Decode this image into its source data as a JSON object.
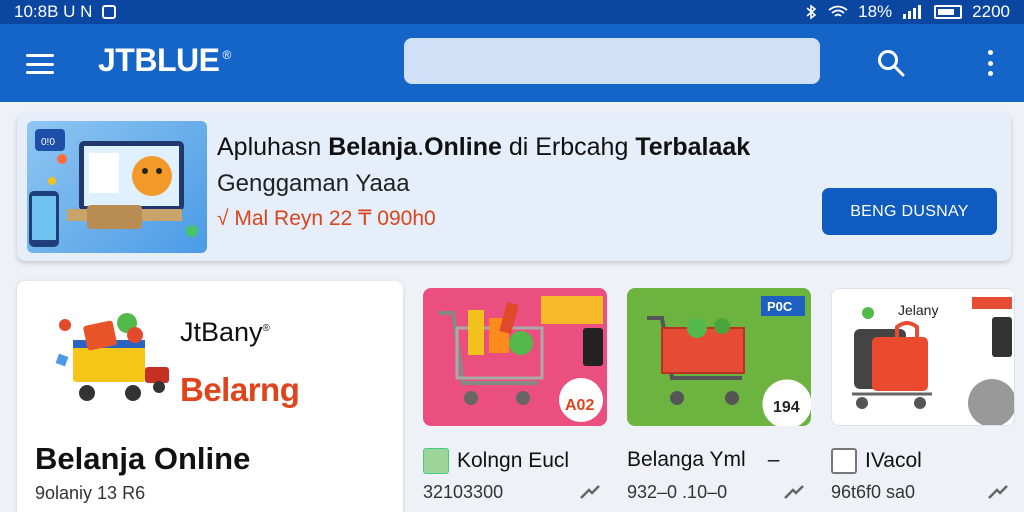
{
  "status_bar": {
    "time": "10:8B U N",
    "battery_pct": "18%",
    "clock_right": "2200"
  },
  "app_bar": {
    "brand": "JTBLUE",
    "brand_mark": "®",
    "search_value": "",
    "menu_icon": "hamburger-icon",
    "search_icon": "search-icon",
    "more_icon": "more-vertical-icon"
  },
  "banner": {
    "title_pre": "Apluhasn ",
    "title_bold1": "Belanja",
    "title_mid1": ".",
    "title_bold2": "Online",
    "title_mid2": " di Erbcahg ",
    "title_bold3": "Terbalaak",
    "subtitle": "Genggaman Yaaa",
    "promo": "√ Mal Reyn 22 ₸ 090h0",
    "cta": "BENG DUSNAY",
    "img_badge": "0!0"
  },
  "featured": {
    "brand": "JtBany",
    "brand_mark": "®",
    "tagline": "Belarng",
    "title": "Belanja Online",
    "subtitle": "9olaniy 13 R6"
  },
  "products": [
    {
      "label": "Kolngn Eucl",
      "price": "32103300",
      "badge_top": "",
      "badge_bottom": "A02",
      "color": "#e8457a"
    },
    {
      "label": "Belanga Yml",
      "price": "932–0 .10–0",
      "badge_top": "P0C",
      "badge_bottom": "194",
      "suffix": "–",
      "color": "#6cb43f"
    },
    {
      "label": "IVacol",
      "price": "96t6f0 sa0",
      "badge_top": "",
      "badge_bottom": "",
      "card_text": "Jelany",
      "color": "#ffffff"
    }
  ],
  "colors": {
    "primary": "#1565c9",
    "status": "#0b47a1",
    "accent": "#e0441c",
    "banner_bg": "#e6eefa"
  }
}
